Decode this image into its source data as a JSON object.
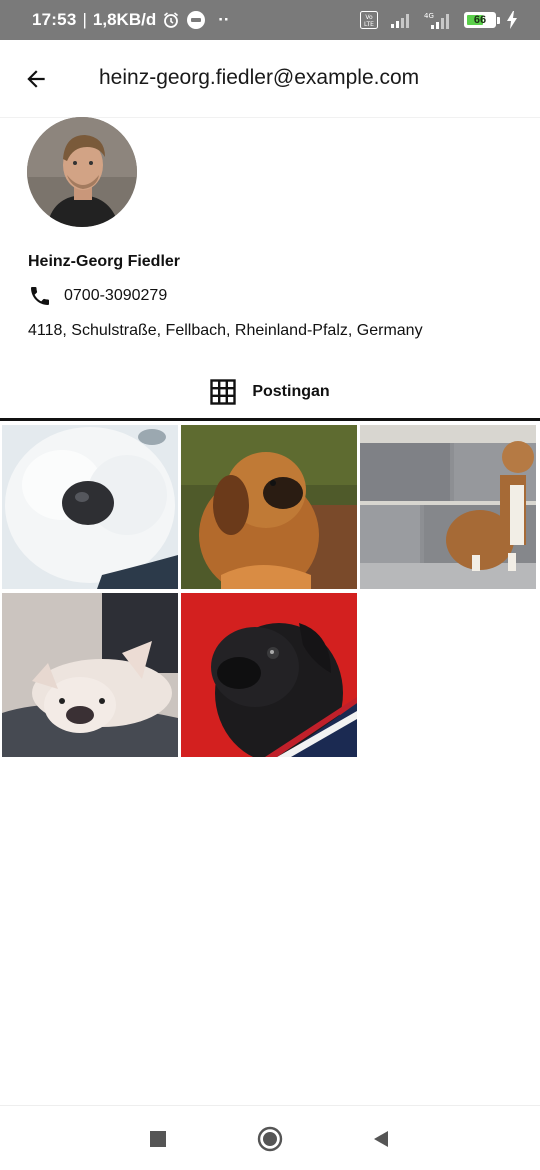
{
  "status_bar": {
    "time": "17:53",
    "separator": "|",
    "network_speed": "1,8KB/d",
    "more_indicator": "··",
    "volte_label": "Vo LTE",
    "network_type": "4G",
    "battery_level": "66",
    "icons": [
      "alarm-icon",
      "messenger-icon",
      "volte-icon",
      "signal-icon",
      "signal-4g-icon",
      "battery-icon",
      "charging-icon"
    ]
  },
  "header": {
    "back_icon": "arrow-left-icon",
    "title": "heinz-georg.fiedler@example.com"
  },
  "profile": {
    "name": "Heinz-Georg Fiedler",
    "phone_icon": "phone-icon",
    "phone": "0700-3090279",
    "address": "4118, Schulstraße, Fellbach, Rheinland-Pfalz, Germany"
  },
  "tabs": [
    {
      "icon": "grid-icon",
      "label": "Postingan",
      "selected": true
    }
  ],
  "posts": [
    {
      "subject": "white fluffy dog close-up",
      "colors": [
        "#dfe6ea",
        "#b9c5cf"
      ]
    },
    {
      "subject": "brown pekingese dog",
      "colors": [
        "#6b5a2a",
        "#b0662a"
      ]
    },
    {
      "subject": "brown and white dog sitting by stone wall",
      "colors": [
        "#8a8c90",
        "#a0693a"
      ]
    },
    {
      "subject": "white french bulldog lying on blanket",
      "colors": [
        "#cfc7c2",
        "#4a4c54"
      ]
    },
    {
      "subject": "black pug on red background",
      "colors": [
        "#d21f1f",
        "#1a1a1a"
      ]
    }
  ],
  "nav_bar": {
    "buttons": [
      "recents-square-icon",
      "home-circle-icon",
      "back-triangle-icon"
    ]
  },
  "colors": {
    "status_bar_bg": "#7a7a7a",
    "text_primary": "#111111",
    "tab_indicator": "#111111",
    "background": "#ffffff"
  }
}
